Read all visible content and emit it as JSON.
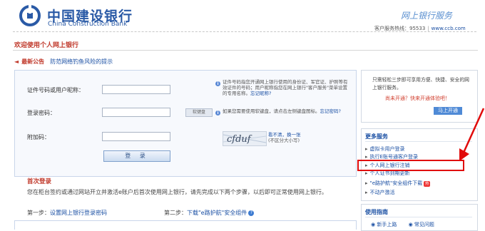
{
  "header": {
    "bank_name_cn": "中国建设银行",
    "bank_name_en": "China Construction Bank",
    "service_title": "网上银行服务",
    "hotline": "客户服务热线：95533",
    "website": "www.ccb.com"
  },
  "welcome": "欢迎使用个人网上银行",
  "notice": {
    "label": "最新公告",
    "text": "防范网络钓鱼风险的提示"
  },
  "login": {
    "id_label": "证件号码或用户昵称：",
    "password_label": "登录密码：",
    "captcha_label": "附加码：",
    "keyboard_label": "软键盘",
    "captcha_text": "cfduf",
    "captcha_refresh": "看不清，换一张",
    "captcha_case": "(不区分大小写)",
    "login_button": "登  录",
    "id_tip": "证件号码指您开通网上银行使用的身份证、军官证、护照等有效证件的号码；用户昵称指您在网上银行\"客户服务\"菜单设置的专用名称。",
    "forgot_nickname": "忘记昵称?",
    "keyboard_tip": "如果您需要使用软键盘，请点击左侧键盘图标。",
    "forgot_password": "忘记密码?"
  },
  "first_login": {
    "title": "首次登录",
    "desc": "您在柜台签约或通过网站开立并激活e账户后首次使用网上银行，请先完成以下两个步骤，以后即可正常使用网上银行。",
    "step1_label": "第一步：",
    "step1_link": "设置网上银行登录密码",
    "step2_label": "第二步：",
    "step2_link": "下载\"e路护航\"安全组件"
  },
  "promo": {
    "text": "只需轻松三步即可享用方便、快捷、安全的网上银行服务。",
    "question": "尚未开通？快来开通体验吧！",
    "open_button": "马上开通"
  },
  "more_services": {
    "title": "更多服务",
    "items": [
      "虚拟卡用户登录",
      "执行E账号通客户登录",
      "个人网上银行注销",
      "个人证书到期更新",
      "\"e路护航\"安全组件下载",
      "不动产激活"
    ],
    "hot_badge": "热"
  },
  "guide": {
    "title": "使用指南",
    "items": [
      "新手上路",
      "常见问题"
    ]
  },
  "colors": {
    "brand_blue": "#2a5aa6",
    "accent_red": "#c0392b",
    "highlight_red": "#e10b0b"
  }
}
